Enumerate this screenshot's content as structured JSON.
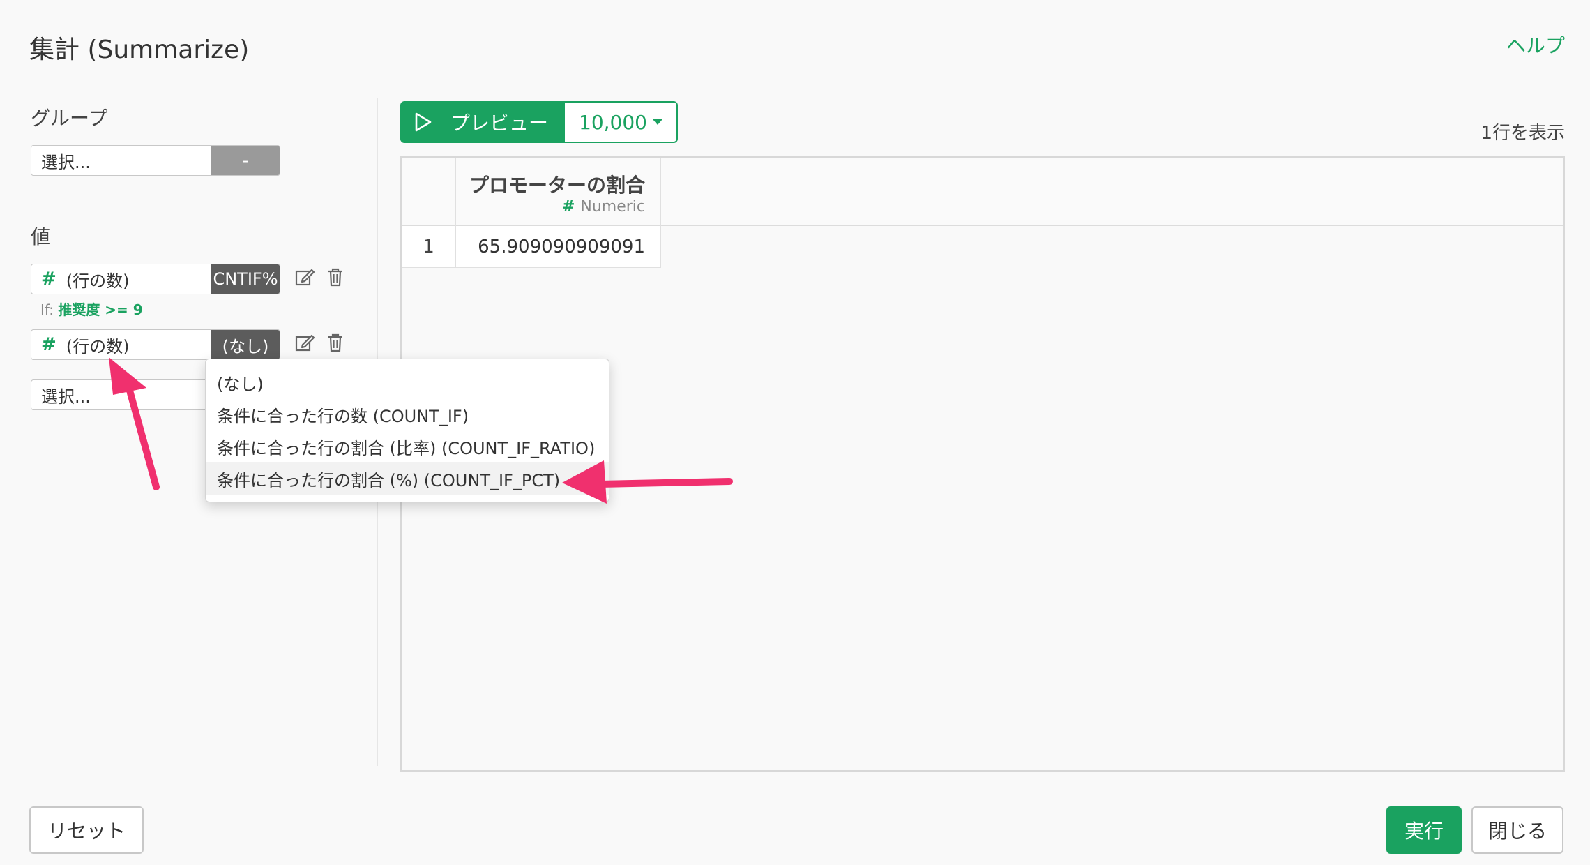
{
  "header": {
    "title": "集計 (Summarize)",
    "help": "ヘルプ"
  },
  "group": {
    "label": "グループ",
    "select_placeholder": "選択...",
    "suffix": "-"
  },
  "values": {
    "label": "値",
    "items": [
      {
        "hash": "#",
        "name": "(行の数)",
        "agg": "CNTIF%",
        "if_prefix": "If:",
        "if_condition": "推奨度 >= 9"
      },
      {
        "hash": "#",
        "name": "(行の数)",
        "agg": "(なし)"
      }
    ],
    "select_placeholder": "選択..."
  },
  "aggregation_menu": {
    "options": [
      "(なし)",
      "条件に合った行の数 (COUNT_IF)",
      "条件に合った行の割合 (比率) (COUNT_IF_RATIO)",
      "条件に合った行の割合 (%) (COUNT_IF_PCT)"
    ]
  },
  "preview": {
    "button_label": "プレビュー",
    "row_limit": "10,000",
    "row_count_text": "1行を表示"
  },
  "table": {
    "columns": [
      {
        "title": "プロモーターの割合",
        "type_hash": "#",
        "type": "Numeric"
      }
    ],
    "rows": [
      {
        "index": "1",
        "values": [
          "65.909090909091"
        ]
      }
    ]
  },
  "footer": {
    "reset": "リセット",
    "run": "実行",
    "close": "閉じる"
  },
  "colors": {
    "accent": "#1aa260",
    "annotation_arrow": "#f0306e"
  }
}
